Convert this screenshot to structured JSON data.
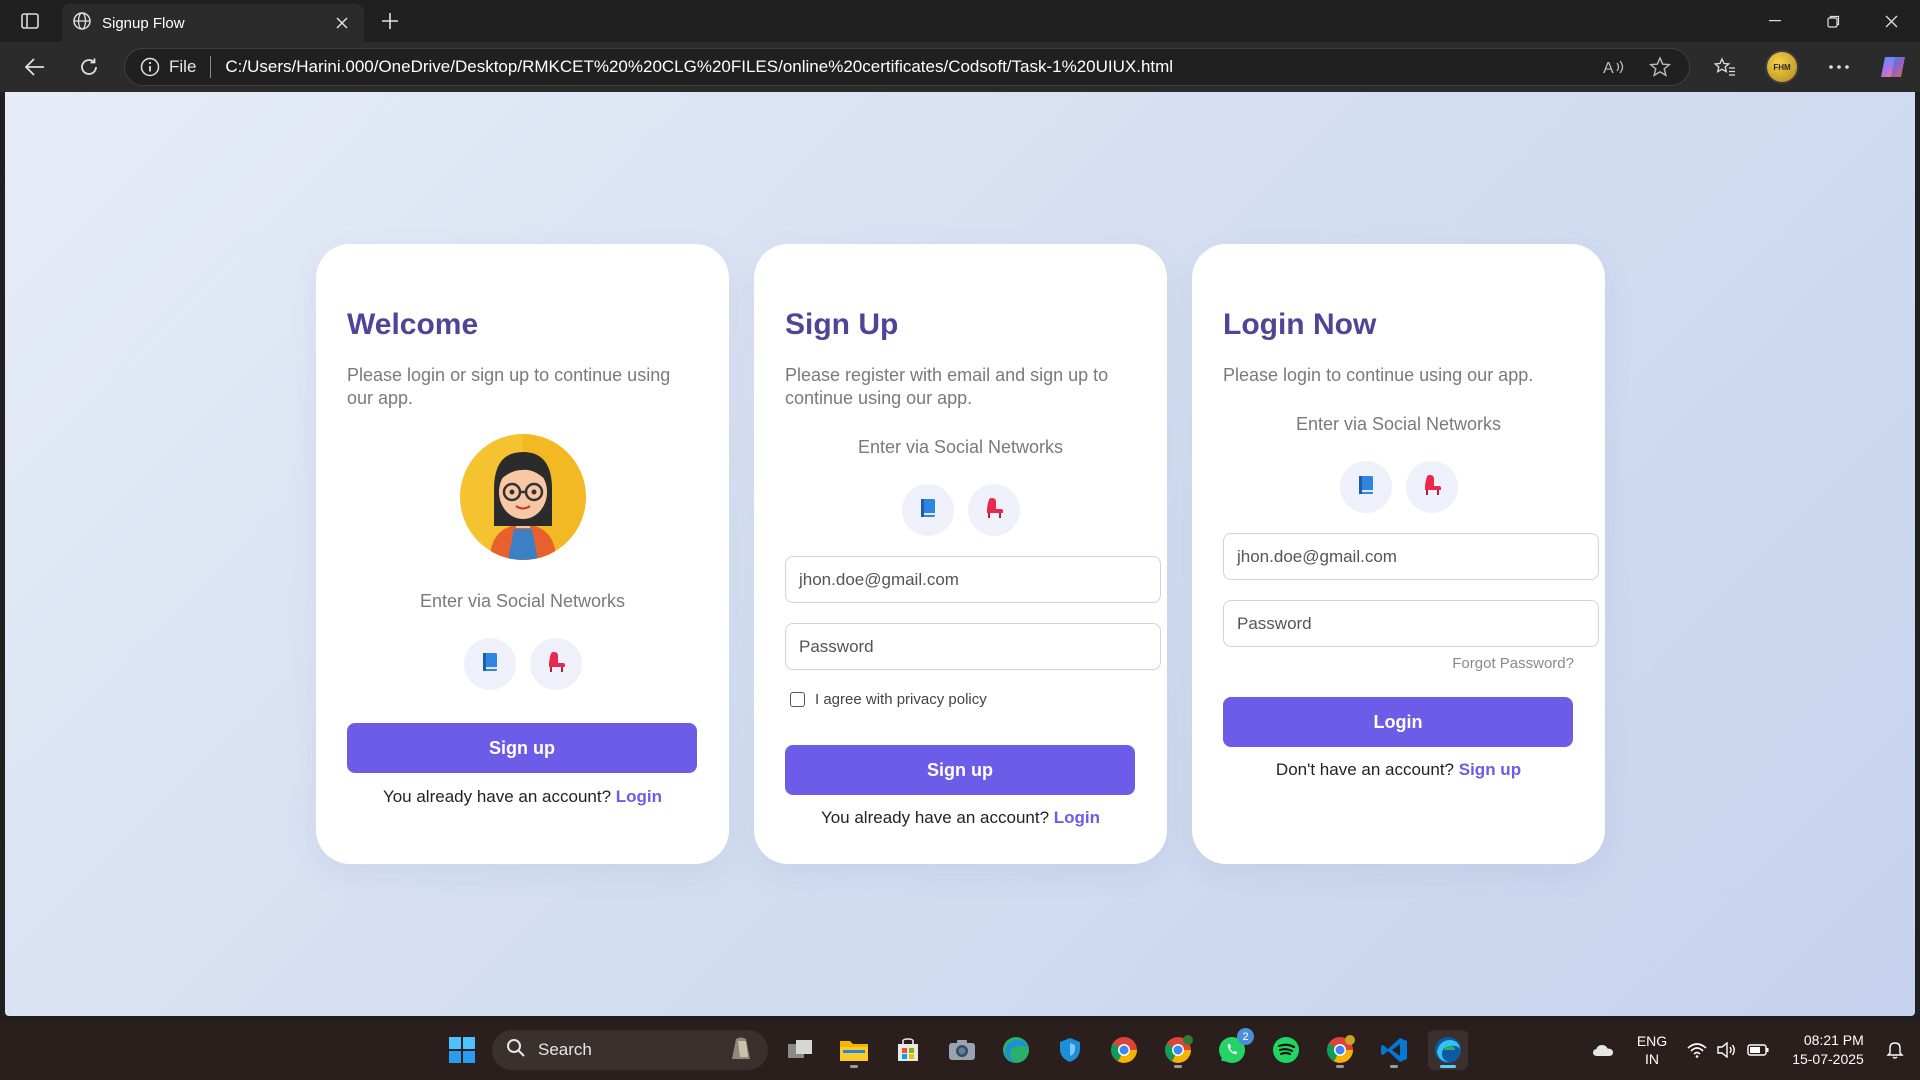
{
  "browser": {
    "tab_title": "Signup Flow",
    "address_prefix": "File",
    "url": "C:/Users/Harini.000/OneDrive/Desktop/RMKCET%20%20CLG%20FILES/online%20certificates/Codsoft/Task-1%20UIUX.html",
    "profile_label": "FHM"
  },
  "cards": {
    "welcome": {
      "title": "Welcome",
      "subtitle": "Please login or sign up to continue using our app.",
      "social_label": "Enter via Social Networks",
      "button": "Sign up",
      "footer_text": "You already have an account?",
      "footer_link": "Login"
    },
    "signup": {
      "title": "Sign Up",
      "subtitle": "Please register with email and sign up to continue using our app.",
      "social_label": "Enter via Social Networks",
      "email_placeholder": "jhon.doe@gmail.com",
      "password_placeholder": "Password",
      "agree_label": "I agree with privacy policy",
      "button": "Sign up",
      "footer_text": "You already have an account?",
      "footer_link": "Login"
    },
    "login": {
      "title": "Login Now",
      "subtitle": "Please login to continue using our app.",
      "social_label": "Enter via Social Networks",
      "email_placeholder": "jhon.doe@gmail.com",
      "password_placeholder": "Password",
      "forgot": "Forgot Password?",
      "button": "Login",
      "footer_text": "Don't have an account?",
      "footer_link": "Sign up"
    }
  },
  "social_icons": [
    "book-icon",
    "chair-icon"
  ],
  "taskbar": {
    "search_label": "Search",
    "lang_line1": "ENG",
    "lang_line2": "IN",
    "time": "08:21 PM",
    "date": "15-07-2025",
    "whatsapp_badge": "2"
  },
  "colors": {
    "accent": "#6c5ce7",
    "title": "#4f4597",
    "background": "#d4def1"
  }
}
